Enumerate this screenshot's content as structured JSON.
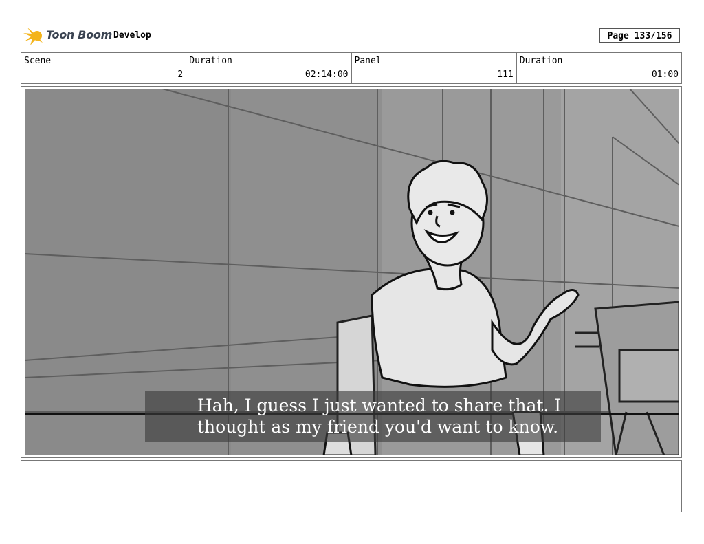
{
  "header": {
    "logo_text": "Toon Boom",
    "project": "Develop",
    "page": "Page 133/156"
  },
  "info": {
    "scene_label": "Scene",
    "scene_value": "2",
    "scene_duration_label": "Duration",
    "scene_duration_value": "02:14:00",
    "panel_label": "Panel",
    "panel_value": "111",
    "panel_duration_label": "Duration",
    "panel_duration_value": "01:00"
  },
  "panel": {
    "subtitle_line1": "Hah, I guess I just wanted to share that. I",
    "subtitle_line2": "thought as my friend you'd want to know."
  },
  "notes": {
    "text": ""
  },
  "colors": {
    "logo_yellow": "#f4b41a",
    "background_gray": "#8f8f8f",
    "figure_fill": "#e6e6e6"
  }
}
